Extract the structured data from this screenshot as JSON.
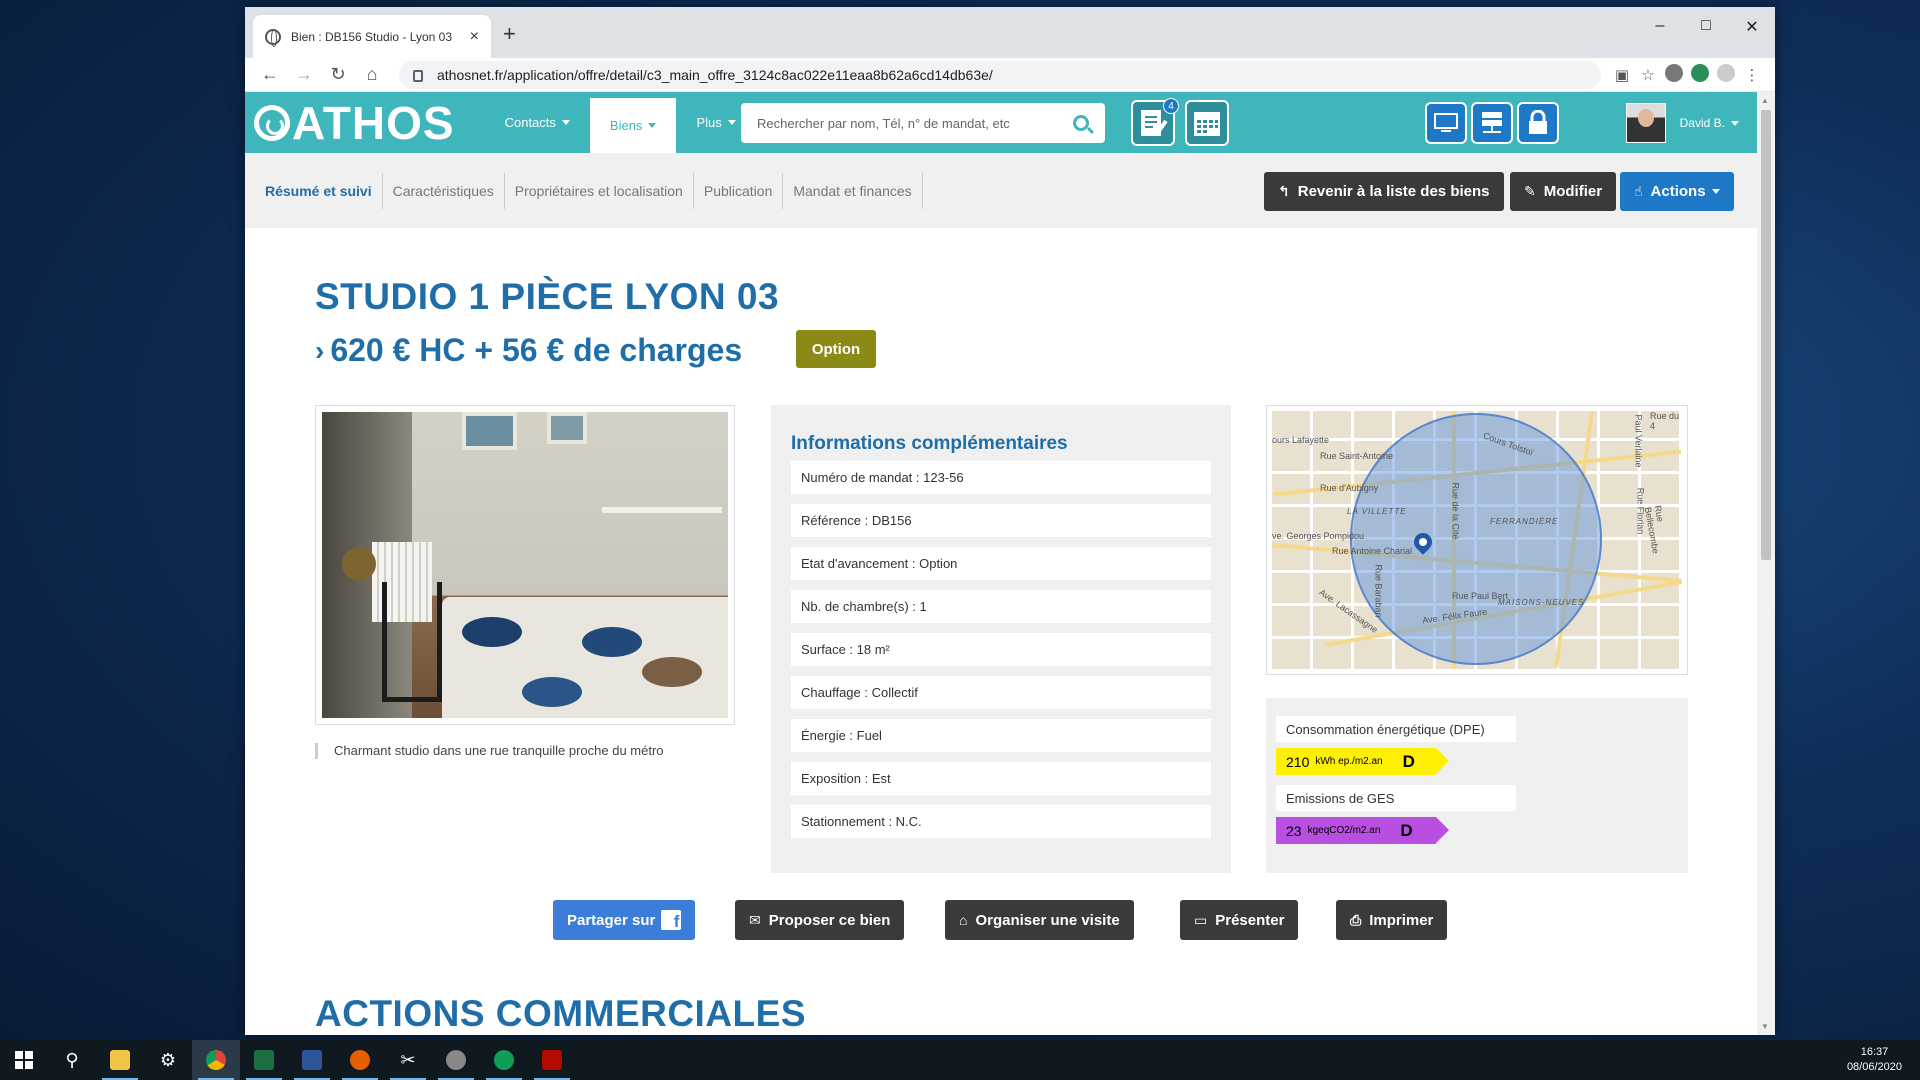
{
  "browser": {
    "tab_title": "Bien : DB156 Studio - Lyon 03",
    "url": "athosnet.fr/application/offre/detail/c3_main_offre_3124c8ac022e11eaa8b62a6cd14db63e/",
    "window_controls": {
      "minimize": "–",
      "maximize": "□",
      "close": "✕"
    }
  },
  "header": {
    "logo": "ATHOS",
    "menu": [
      {
        "label": "Contacts",
        "active": false
      },
      {
        "label": "Biens",
        "active": true
      },
      {
        "label": "Plus",
        "active": false
      }
    ],
    "search_placeholder": "Rechercher par nom, Tél, n° de mandat, etc",
    "notif_count": "4",
    "user_name": "David B."
  },
  "subnav": {
    "tabs": [
      {
        "label": "Résumé et suivi",
        "active": true
      },
      {
        "label": "Caractéristiques",
        "active": false
      },
      {
        "label": "Propriétaires et localisation",
        "active": false
      },
      {
        "label": "Publication",
        "active": false
      },
      {
        "label": "Mandat et finances",
        "active": false
      }
    ],
    "back_label": "Revenir à la liste des biens",
    "edit_label": "Modifier",
    "actions_label": "Actions"
  },
  "listing": {
    "title": "STUDIO 1 PIÈCE LYON 03",
    "price": "620 € HC + 56 € de charges",
    "status_badge": "Option",
    "caption": "Charmant studio dans une rue tranquille proche du métro"
  },
  "info": {
    "title": "Informations complémentaires",
    "rows": [
      "Numéro de mandat : 123-56",
      "Référence : DB156",
      "Etat d'avancement : Option",
      "Nb. de chambre(s) : 1",
      "Surface : 18 m²",
      "Chauffage : Collectif",
      "Énergie : Fuel",
      "Exposition : Est",
      "Stationnement : N.C."
    ]
  },
  "map": {
    "labels": [
      "ours Lafayette",
      "Rue Saint-Antoine",
      "Rue d'Aubigny",
      "LA VILLETTE",
      "FERRANDIÈRE",
      "ve. Georges Pompidou",
      "Rue Antoine Charial",
      "Rue Paul Bert",
      "MAISONS-NEUVES",
      "Cours Tolstoï",
      "Rue du 4",
      "Rue de la Cité",
      "Rue Florian",
      "Rue Baraban",
      "Ave. Lacassagne",
      "Ave. Félix Faure",
      "Rue Bellecombe",
      "Paul Verlaine"
    ]
  },
  "dpe": {
    "conso_label": "Consommation énergétique (DPE)",
    "conso_value": "210",
    "conso_unit": "kWh ep./m2.an",
    "conso_letter": "D",
    "ges_label": "Emissions de GES",
    "ges_value": "23",
    "ges_unit": "kgeqCO2/m2.an",
    "ges_letter": "D",
    "colors": {
      "conso": "#ffef00",
      "ges": "#b84fe0"
    }
  },
  "actions": {
    "share": "Partager sur",
    "share_icon": "f",
    "propose": "Proposer ce bien",
    "visit": "Organiser une visite",
    "present": "Présenter",
    "print": "Imprimer"
  },
  "section_title": "ACTIONS COMMERCIALES",
  "taskbar": {
    "time": "16:37",
    "date": "08/06/2020"
  },
  "colors": {
    "brand_teal": "#3fb6bb",
    "title_blue": "#1f6ea8",
    "button_dark": "#3a3a3a",
    "button_blue": "#1e78c8",
    "badge_olive": "#8a8a14"
  }
}
